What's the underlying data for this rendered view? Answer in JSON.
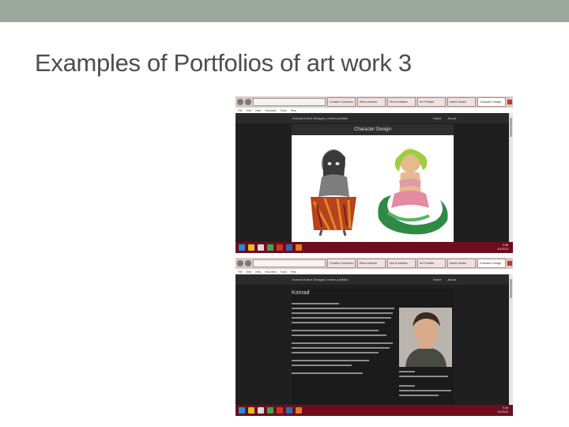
{
  "slide": {
    "title": "Examples of Portfolios of art work 3"
  },
  "screenshots": [
    {
      "tabs": [
        "Creative Commons",
        "Retro collectio",
        "Mix of hobbies",
        "Art Portfolio",
        "Mark's Studio",
        "Character Design"
      ],
      "menu": [
        "File",
        "Edit",
        "View",
        "Favorites",
        "Tools",
        "Help"
      ],
      "site_name": "Konrad Kuech Designs  |  online portfolio",
      "nav_links": [
        "Home",
        "About"
      ],
      "panel_title": "Character Design",
      "clock_time": "9:48",
      "clock_date": "4/1/2013"
    },
    {
      "tabs": [
        "Creative Commons",
        "Retro collectio",
        "Mix of hobbies",
        "Art Portfolio",
        "Mark's Studio",
        "Character Design"
      ],
      "menu": [
        "File",
        "Edit",
        "View",
        "Favorites",
        "Tools",
        "Help"
      ],
      "site_name": "Konrad Kuech Designs  |  online portfolio",
      "nav_links": [
        "Home",
        "About"
      ],
      "page_heading": "Konrad",
      "clock_time": "9:49",
      "clock_date": "4/1/2013"
    }
  ],
  "colors": {
    "topbar": "#9aa89e",
    "taskbar": "#6e0d1c",
    "site_bg": "#1f1f1f"
  }
}
